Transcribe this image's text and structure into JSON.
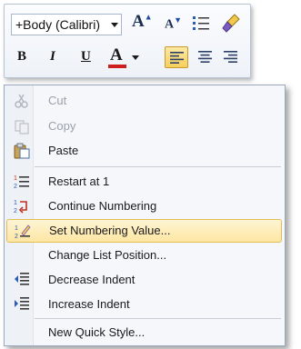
{
  "mini_toolbar": {
    "font_name": "+Body (Calibri)",
    "grow_font_glyph": "A",
    "shrink_font_glyph": "A",
    "bold_glyph": "B",
    "italic_glyph": "I",
    "underline_glyph": "U",
    "font_color_glyph": "A",
    "font_color": "#cc1f1f",
    "align_active": "align-left"
  },
  "context_menu": {
    "items": [
      {
        "label": "Cut",
        "icon": "scissors-icon",
        "enabled": false
      },
      {
        "label": "Copy",
        "icon": "copy-icon",
        "enabled": false
      },
      {
        "label": "Paste",
        "icon": "paste-icon",
        "enabled": true
      },
      {
        "label": "Restart at 1",
        "icon": "restart-numbering-icon",
        "enabled": true
      },
      {
        "label": "Continue Numbering",
        "icon": "continue-numbering-icon",
        "enabled": true
      },
      {
        "label": "Set Numbering Value...",
        "icon": "set-numbering-value-icon",
        "enabled": true,
        "highlighted": true
      },
      {
        "label": "Change List Position...",
        "icon": "",
        "enabled": true
      },
      {
        "label": "Decrease Indent",
        "icon": "decrease-indent-icon",
        "enabled": true
      },
      {
        "label": "Increase Indent",
        "icon": "increase-indent-icon",
        "enabled": true
      },
      {
        "label": "New Quick Style...",
        "icon": "",
        "enabled": true
      }
    ]
  },
  "colors": {
    "highlight": "#fde6a3",
    "disabled_text": "#9aa1ab"
  }
}
